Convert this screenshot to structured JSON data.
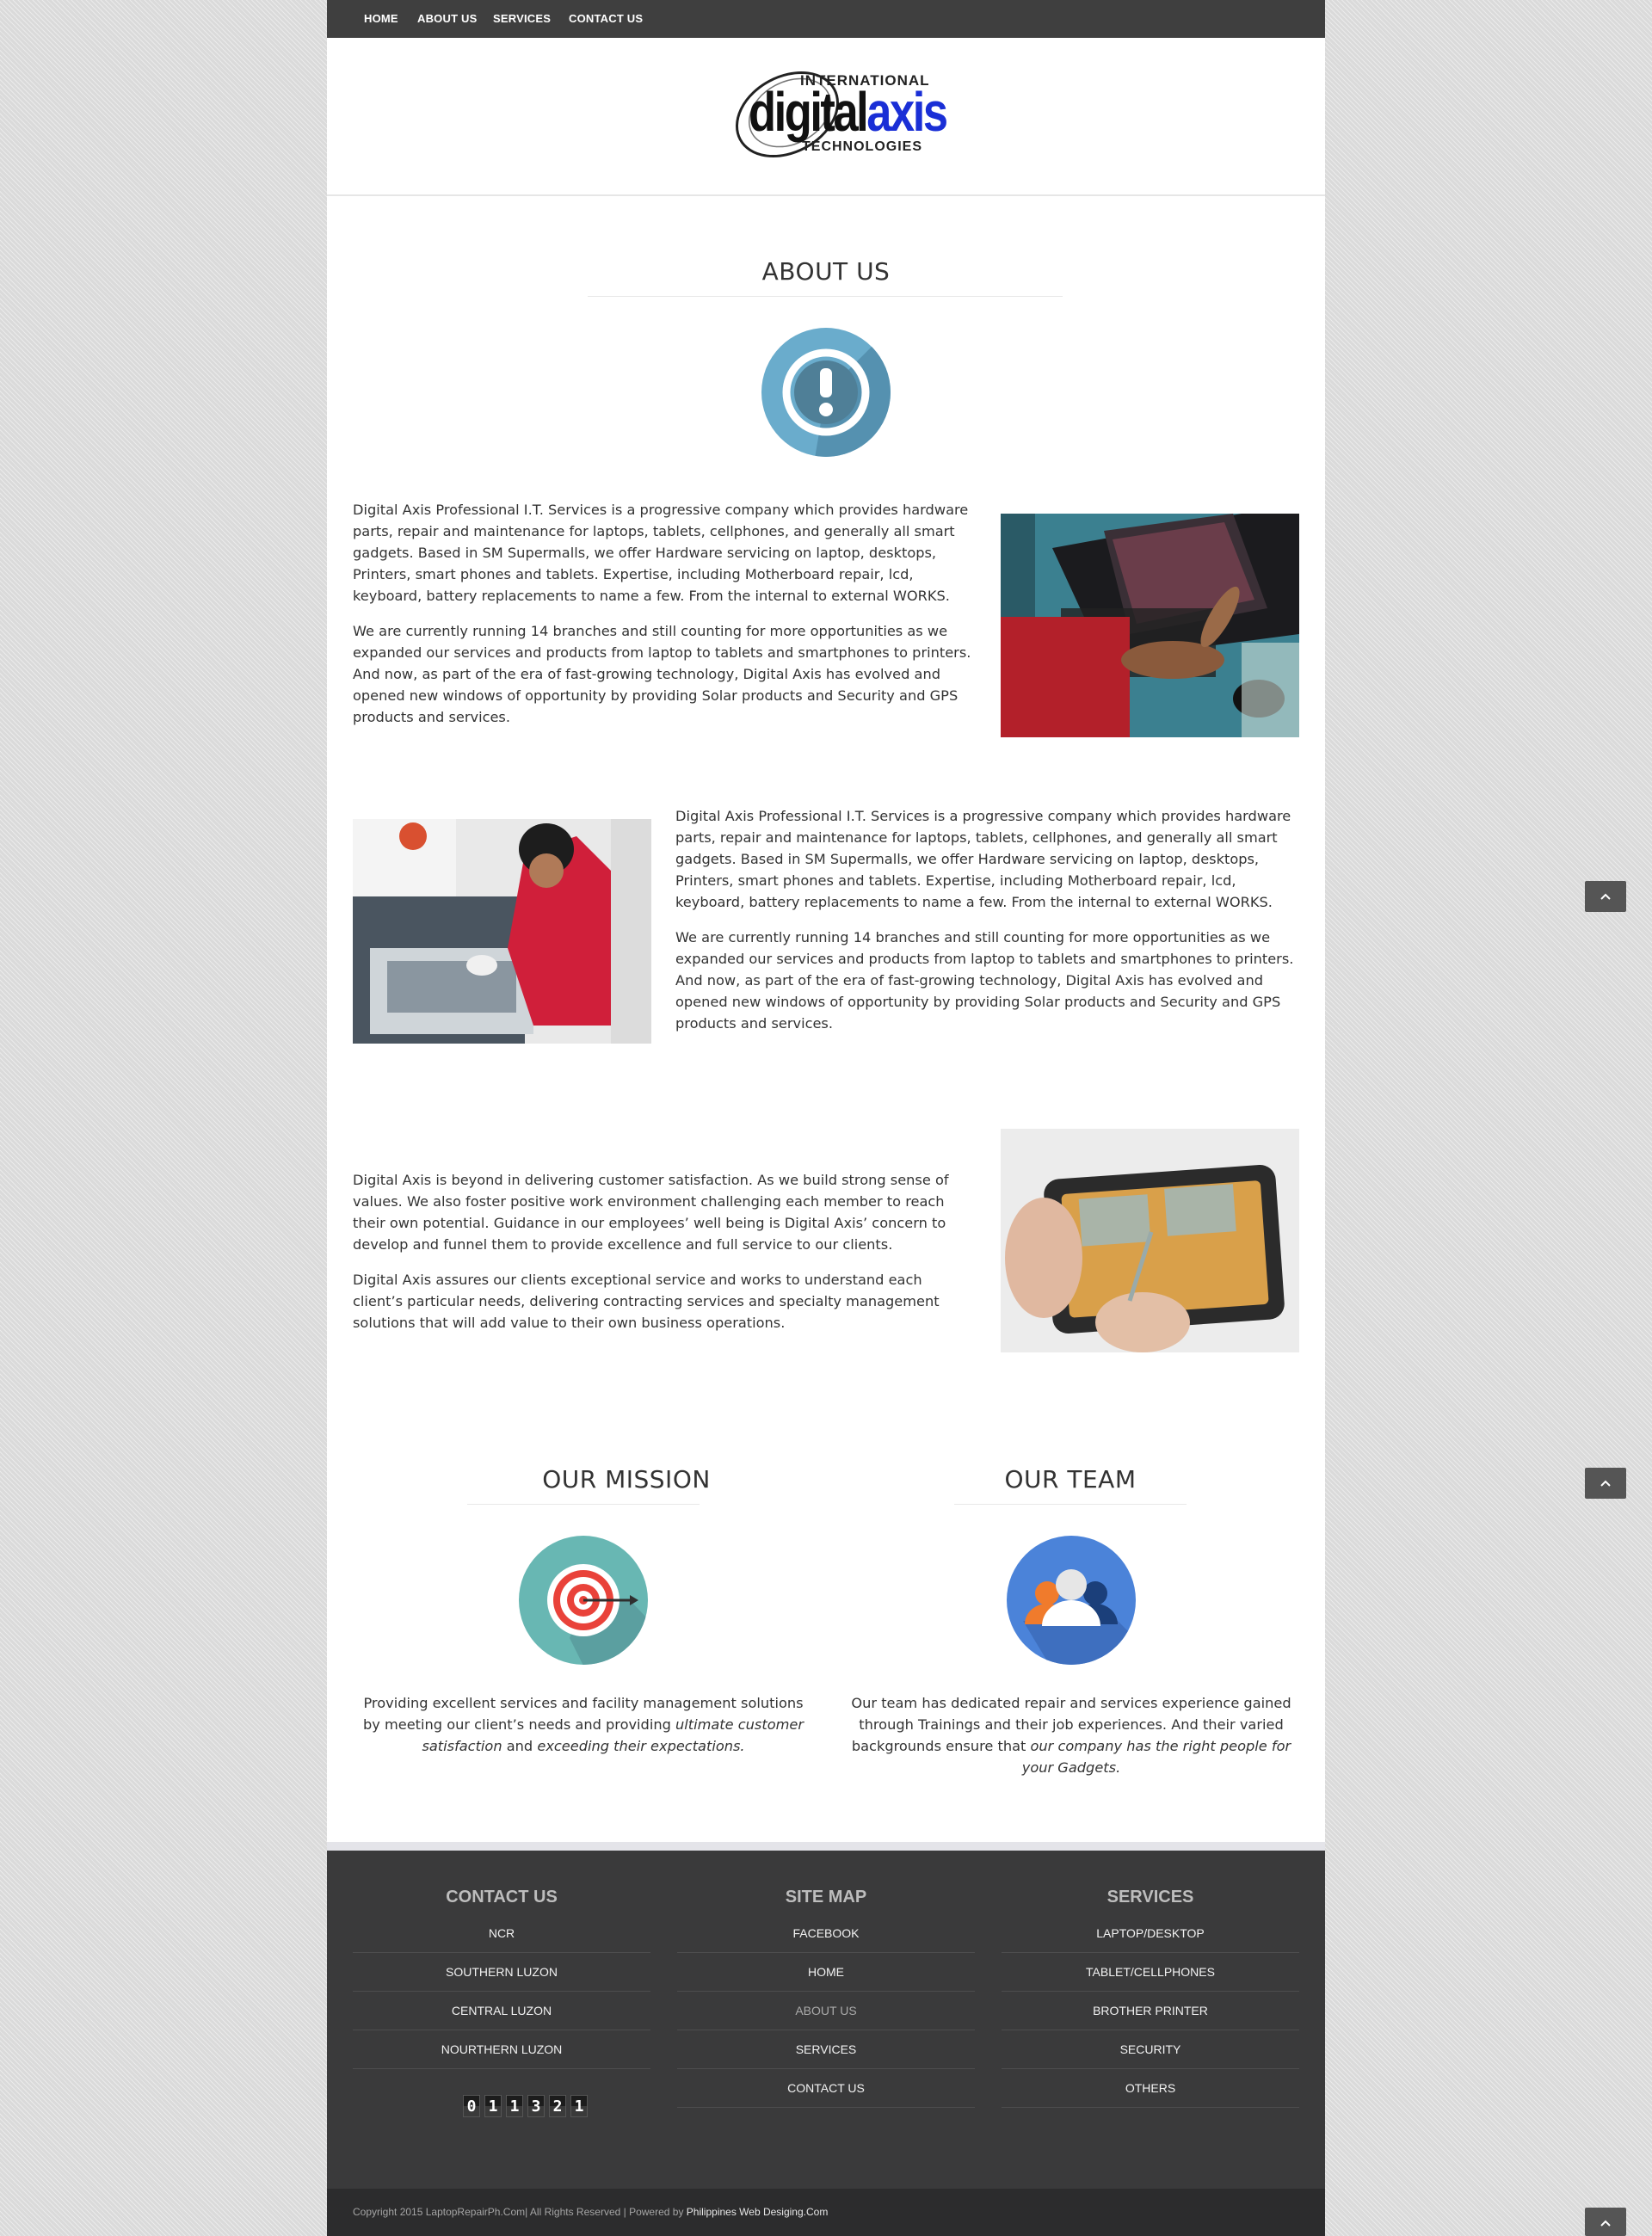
{
  "nav": {
    "items": [
      "HOME",
      "ABOUT US",
      "SERVICES",
      "CONTACT US"
    ]
  },
  "logo": {
    "top": "INTERNATIONAL",
    "main_dark": "digital",
    "main_accent": "axis",
    "bottom": "TECHNOLOGIES"
  },
  "about": {
    "title": "ABOUT US",
    "icon": "exclamation-icon",
    "block1": {
      "p1": "Digital Axis Professional I.T. Services is a progressive company which provides hardware parts, repair and maintenance for laptops, tablets, cellphones, and generally all smart gadgets. Based in SM Supermalls, we offer Hardware servicing on laptop, desktops, Printers, smart phones and tablets. Expertise, including Motherboard repair, lcd, keyboard, battery replacements to name a few. From the internal to external WORKS.",
      "p2": "We are currently running 14 branches and still counting for more opportunities as we expanded our services and products from laptop to tablets and smartphones to printers. And now, as part of the era of fast-growing technology, Digital Axis has evolved and opened new windows of opportunity by providing Solar products and Security and GPS products and services."
    },
    "block2": {
      "p1": "Digital Axis Professional I.T. Services is a progressive company which provides hardware parts, repair and maintenance for laptops, tablets, cellphones, and generally all smart gadgets. Based in SM Supermalls, we offer Hardware servicing on laptop, desktops, Printers, smart phones and tablets. Expertise, including Motherboard repair, lcd, keyboard, battery replacements to name a few. From the internal to external WORKS.",
      "p2": "We are currently running 14 branches and still counting for more opportunities as we expanded our services and products from laptop to tablets and smartphones to printers. And now, as part of the era of fast-growing technology, Digital Axis has evolved and opened new windows of opportunity by providing Solar products and Security and GPS products and services."
    },
    "block3": {
      "p1": "Digital Axis is beyond in delivering customer satisfaction. As we build strong sense of values. We also foster positive work environment challenging each member to reach their own potential. Guidance in our employees’ well being is Digital Axis’ concern to develop and funnel them to provide excellence and full service to our clients.",
      "p2": "Digital Axis assures our clients exceptional service and works to understand each client’s particular needs, delivering contracting services and specialty management solutions that will add value to their own business operations."
    }
  },
  "mission": {
    "title": "OUR MISSION",
    "icon": "target-icon",
    "text_a": "Providing excellent services and facility management solutions by meeting our client’s needs and providing ",
    "text_em1": "ultimate customer satisfaction",
    "text_b": " and ",
    "text_em2": "exceeding their expectations.",
    "text_c": ""
  },
  "team": {
    "title": "OUR TEAM",
    "icon": "team-icon",
    "text_a": "Our team has dedicated repair and services experience gained through Trainings and their job experiences. And their varied backgrounds ensure that ",
    "text_em1": "our company has the right people for your Gadgets."
  },
  "footer": {
    "contact": {
      "title": "CONTACT US",
      "items": [
        "NCR",
        "SOUTHERN LUZON",
        "CENTRAL LUZON",
        "NOURTHERN LUZON"
      ]
    },
    "sitemap": {
      "title": "SITE MAP",
      "items": [
        "FACEBOOK",
        "HOME",
        "ABOUT US",
        "SERVICES",
        "CONTACT US"
      ]
    },
    "services": {
      "title": "SERVICES",
      "items": [
        "LAPTOP/DESKTOP",
        "TABLET/CELLPHONES",
        "BROTHER PRINTER",
        "SECURITY",
        "OTHERS"
      ]
    },
    "counter_digits": [
      "0",
      "1",
      "1",
      "3",
      "2",
      "1"
    ],
    "copyright": "Copyright 2015 LaptopRepairPh.Com| All Rights Reserved | Powered by",
    "powered_by": "Philippines Web Desiging.Com"
  },
  "colors": {
    "nav_bg": "#3f3f3f",
    "footer_bg": "#3a3a3b",
    "accent_blue": "#1a2fd6",
    "icon_about": "#6aaccc",
    "icon_mission": "#68b7b3",
    "icon_team": "#4b83d9"
  }
}
